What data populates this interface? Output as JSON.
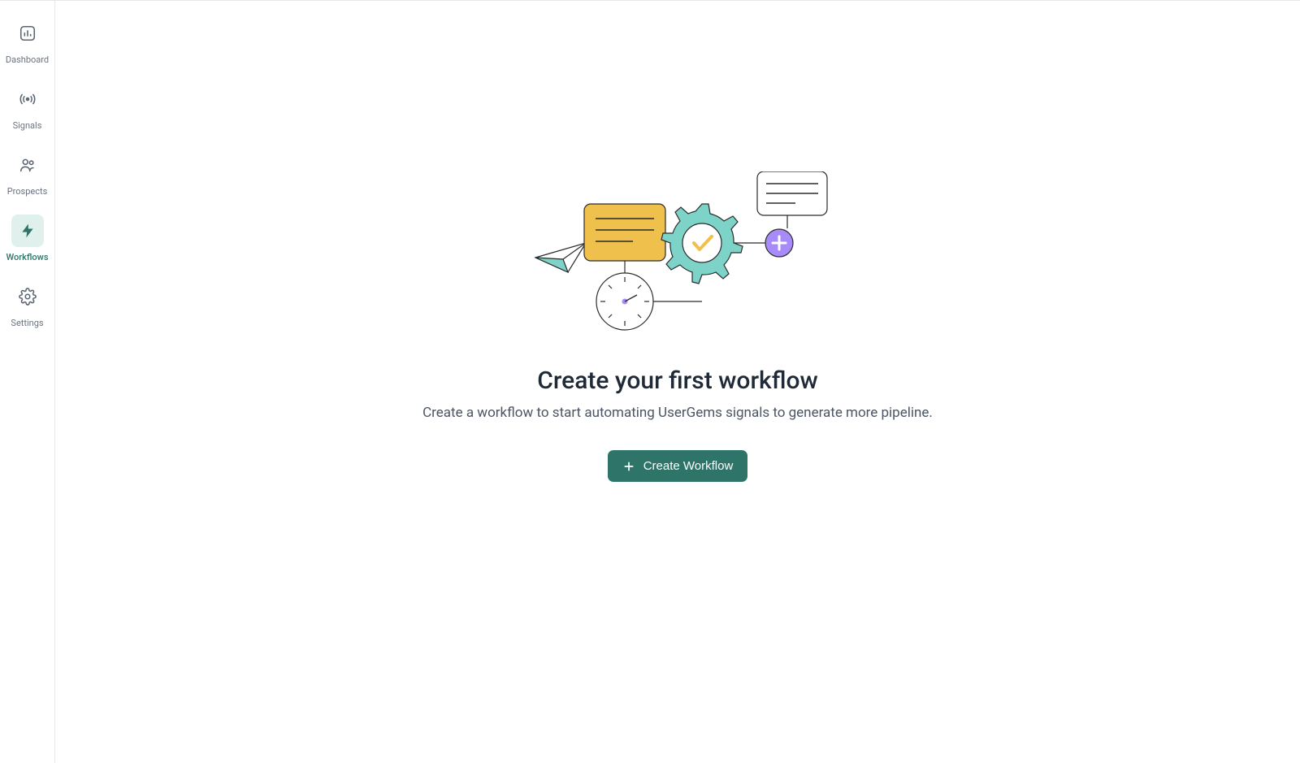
{
  "sidebar": {
    "items": [
      {
        "label": "Dashboard"
      },
      {
        "label": "Signals"
      },
      {
        "label": "Prospects"
      },
      {
        "label": "Workflows"
      },
      {
        "label": "Settings"
      }
    ]
  },
  "main": {
    "empty_state": {
      "title": "Create your first workflow",
      "subtitle": "Create a workflow to start automating UserGems signals to generate more pipeline.",
      "button_label": "Create Workflow"
    }
  },
  "colors": {
    "accent": "#2f7468",
    "accent_bg": "#dff0ed",
    "muted": "#6b7280"
  }
}
